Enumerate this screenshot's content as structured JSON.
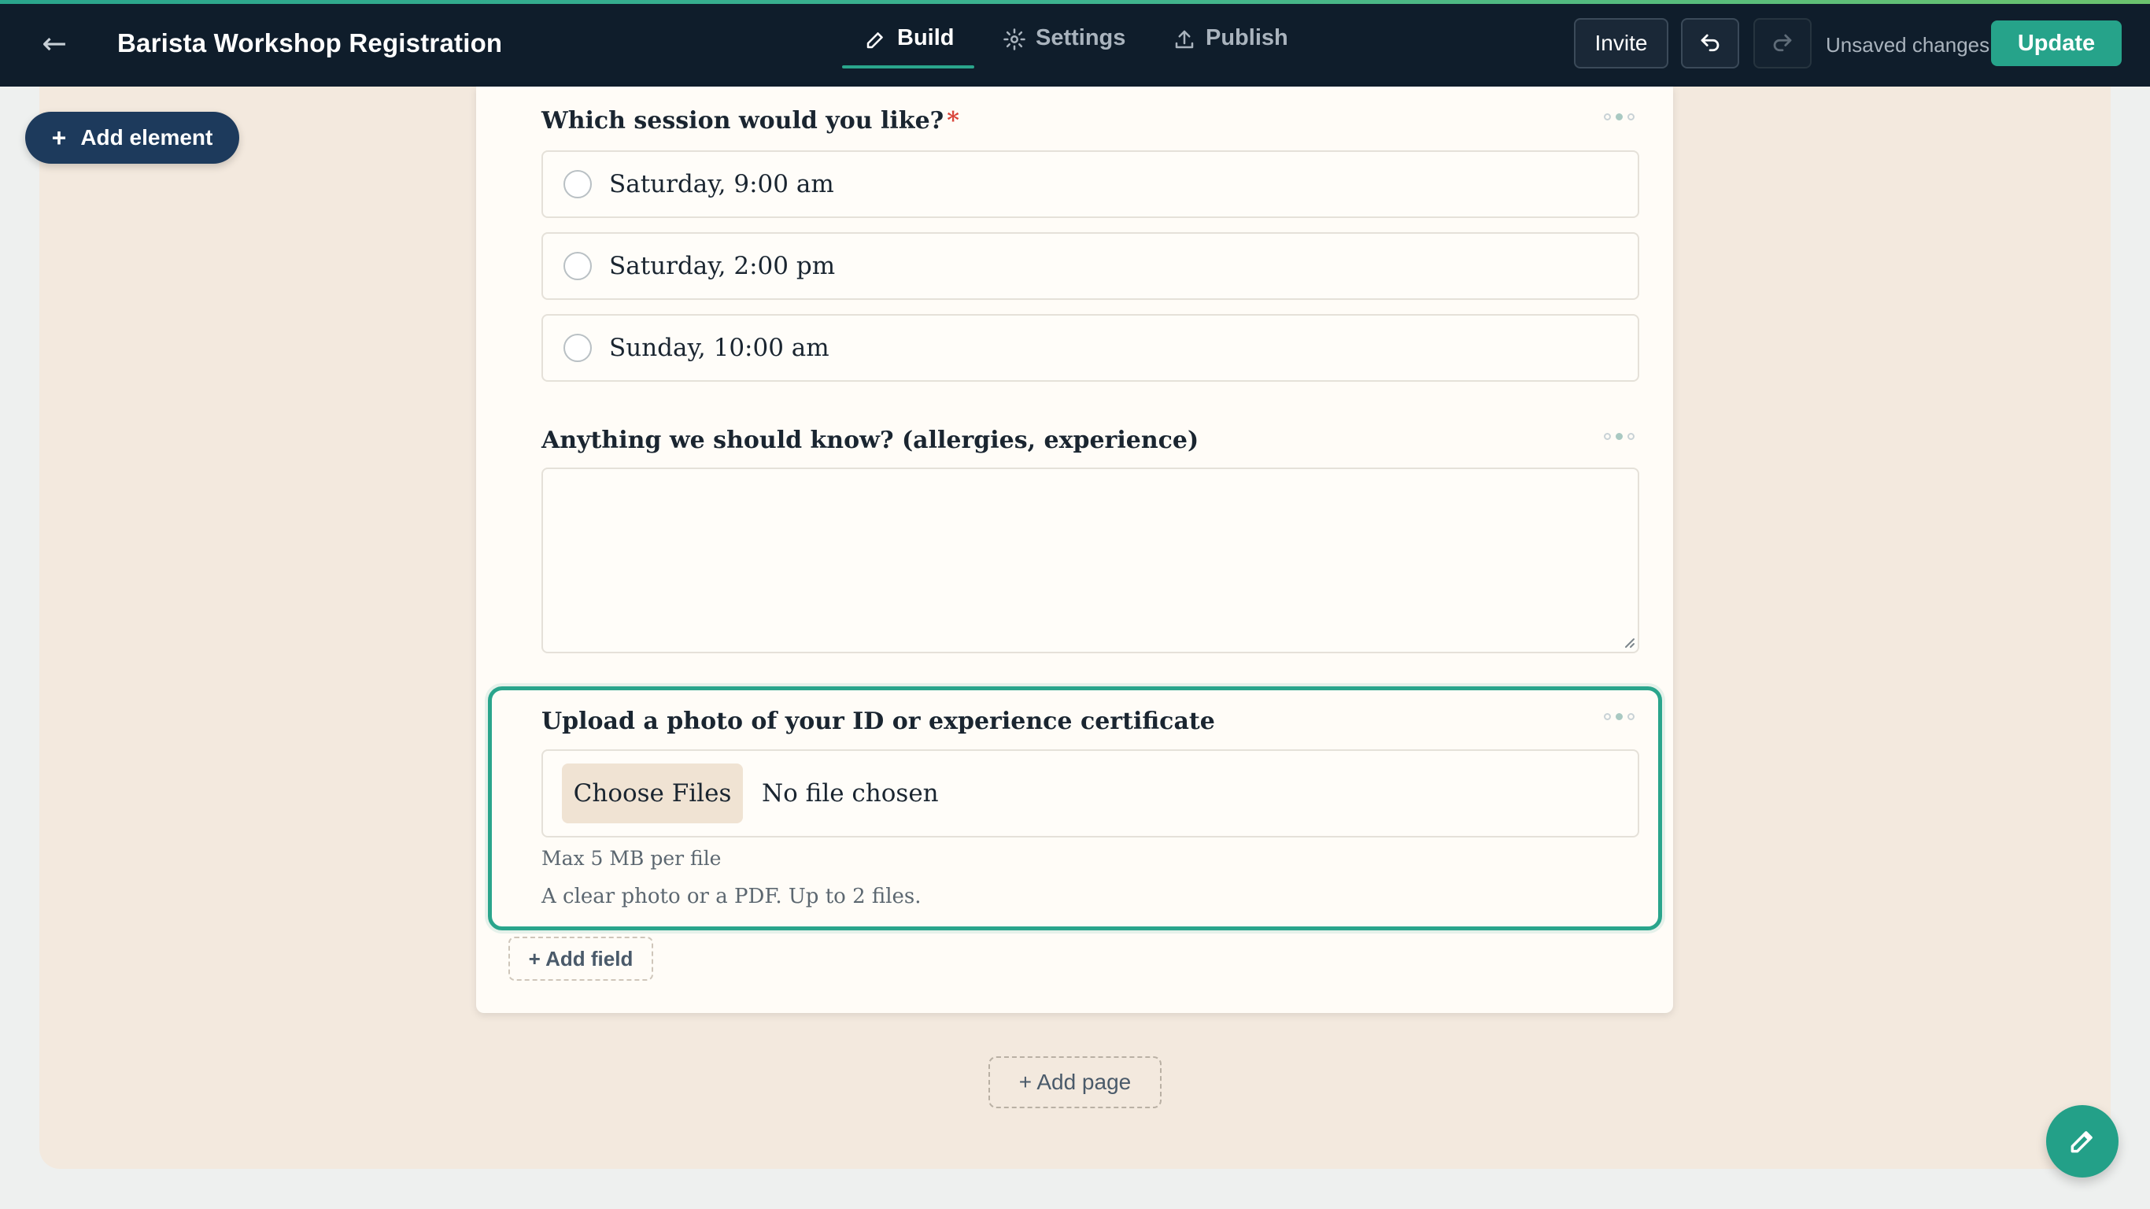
{
  "header": {
    "title": "Barista Workshop Registration",
    "tabs": [
      {
        "label": "Build",
        "icon": "pencil-icon",
        "active": true
      },
      {
        "label": "Settings",
        "icon": "gear-icon",
        "active": false
      },
      {
        "label": "Publish",
        "icon": "upload-icon",
        "active": false
      }
    ],
    "invite_label": "Invite",
    "status_text": "Unsaved changes",
    "update_label": "Update"
  },
  "sidebar": {
    "add_element_label": "Add element"
  },
  "form": {
    "fields": [
      {
        "label": "Which session would you like?",
        "required_mark": "*",
        "type": "radio",
        "options": [
          "Saturday, 9:00 am",
          "Saturday, 2:00 pm",
          "Sunday, 10:00 am"
        ]
      },
      {
        "label": "Anything we should know? (allergies, experience)",
        "type": "textarea",
        "value": ""
      },
      {
        "label": "Upload a photo of your ID or experience certificate",
        "type": "file",
        "choose_label": "Choose Files",
        "no_file_text": "No file chosen",
        "size_hint": "Max 5 MB per file",
        "help_text": "A clear photo or a PDF. Up to 2 files."
      }
    ],
    "add_field_label": "+ Add field",
    "add_page_label": "+ Add page"
  },
  "colors": {
    "header_bg": "#0f1d2b",
    "accent": "#2aa58c",
    "canvas_bg": "#f3e9de",
    "card_bg": "#fffcf7",
    "required": "#d9443a"
  }
}
